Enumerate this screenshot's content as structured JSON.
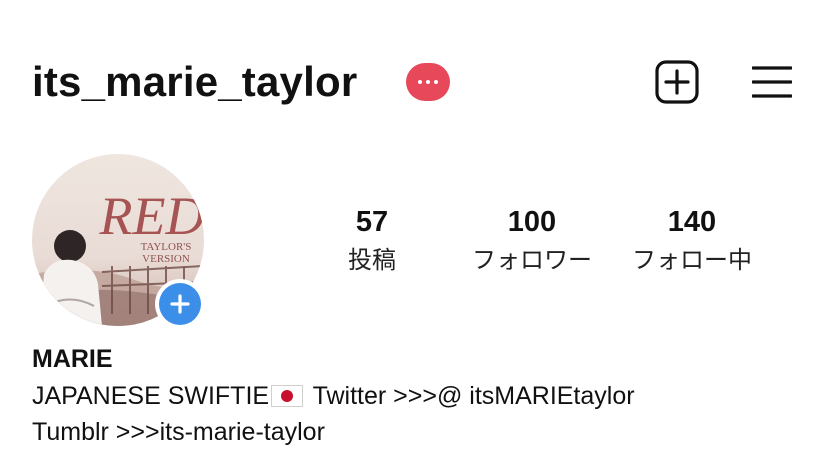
{
  "header": {
    "username": "its_marie_taylor",
    "notification_icon": "more-dots-icon",
    "notification_color": "#e8495a",
    "create_icon": "plus-square-icon",
    "menu_icon": "hamburger-menu-icon"
  },
  "profile": {
    "avatar_text_large": "RED",
    "avatar_text_small_1": "TAYLOR'S",
    "avatar_text_small_2": "VERSION",
    "avatar_add_icon": "plus-icon",
    "avatar_add_color": "#3b8fe8"
  },
  "stats": {
    "posts": {
      "value": "57",
      "label": "投稿"
    },
    "followers": {
      "value": "100",
      "label": "フォロワー"
    },
    "following": {
      "value": "140",
      "label": "フォロー中"
    }
  },
  "bio": {
    "name": "MARIE",
    "line1_before_flag": "JAPANESE SWIFTIE",
    "flag_icon": "japan-flag-icon",
    "line1_after_flag": " Twitter >>>@ itsMARIEtaylor",
    "line2": "Tumblr >>>its-marie-taylor"
  }
}
